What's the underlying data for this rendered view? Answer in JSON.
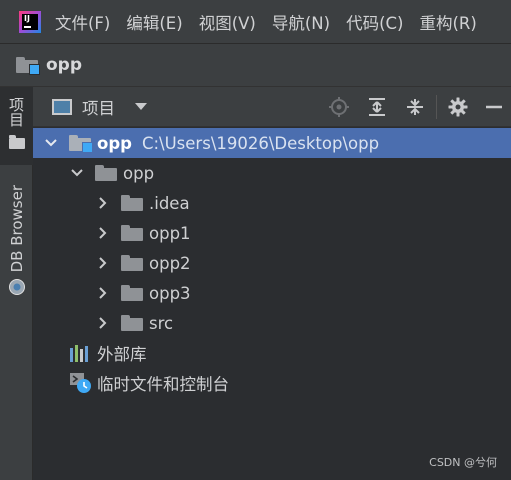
{
  "menu": {
    "items": [
      "文件(F)",
      "编辑(E)",
      "视图(V)",
      "导航(N)",
      "代码(C)",
      "重构(R)"
    ]
  },
  "navbar": {
    "project_name": "opp"
  },
  "stripe": {
    "project_tab": "项目",
    "db_browser_tab": "DB Browser"
  },
  "panel": {
    "title": "项目",
    "view_dropdown": "项目"
  },
  "tree": {
    "root": {
      "name": "opp",
      "path": "C:\\Users\\19026\\Desktop\\opp"
    },
    "module": {
      "name": "opp"
    },
    "folders": [
      ".idea",
      "opp1",
      "opp2",
      "opp3",
      "src"
    ],
    "external_libraries": "外部库",
    "scratches": "临时文件和控制台"
  },
  "watermark": "CSDN @兮何",
  "colors": {
    "background": "#2b2d30",
    "chrome": "#3c3f41",
    "selection": "#4b6eaf",
    "folder": "#8f9296",
    "module_marker": "#3fa9f5"
  }
}
